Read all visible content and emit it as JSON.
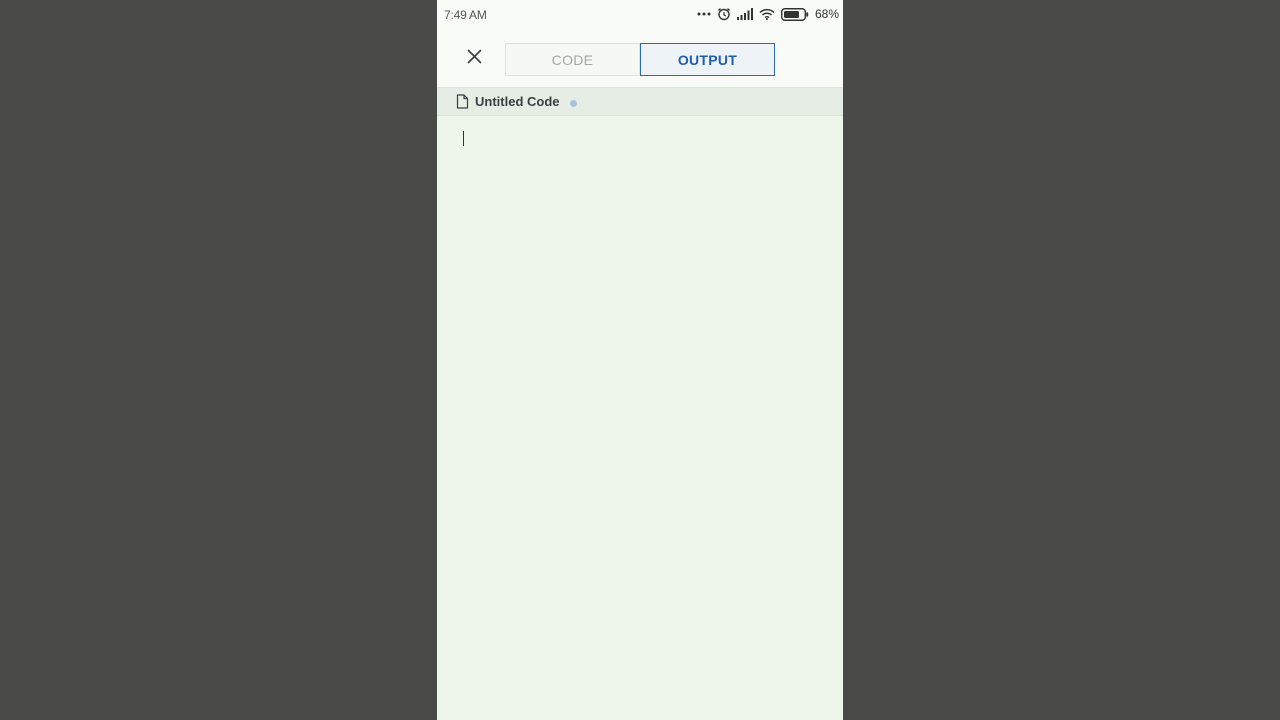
{
  "status_bar": {
    "time": "7:49 AM",
    "battery_percent": "68%",
    "icons": [
      "more-dots-icon",
      "alarm-icon",
      "signal-icon",
      "wifi-icon",
      "battery-icon"
    ]
  },
  "toolbar": {
    "close_icon": "close-icon",
    "tabs": [
      {
        "label": "CODE",
        "active": false
      },
      {
        "label": "OUTPUT",
        "active": true
      }
    ]
  },
  "file": {
    "name": "Untitled Code",
    "icon": "file-icon",
    "unsaved": true
  },
  "colors": {
    "accent": "#1f5ea8",
    "background": "#eef6ec",
    "outer": "#4a4b48"
  }
}
